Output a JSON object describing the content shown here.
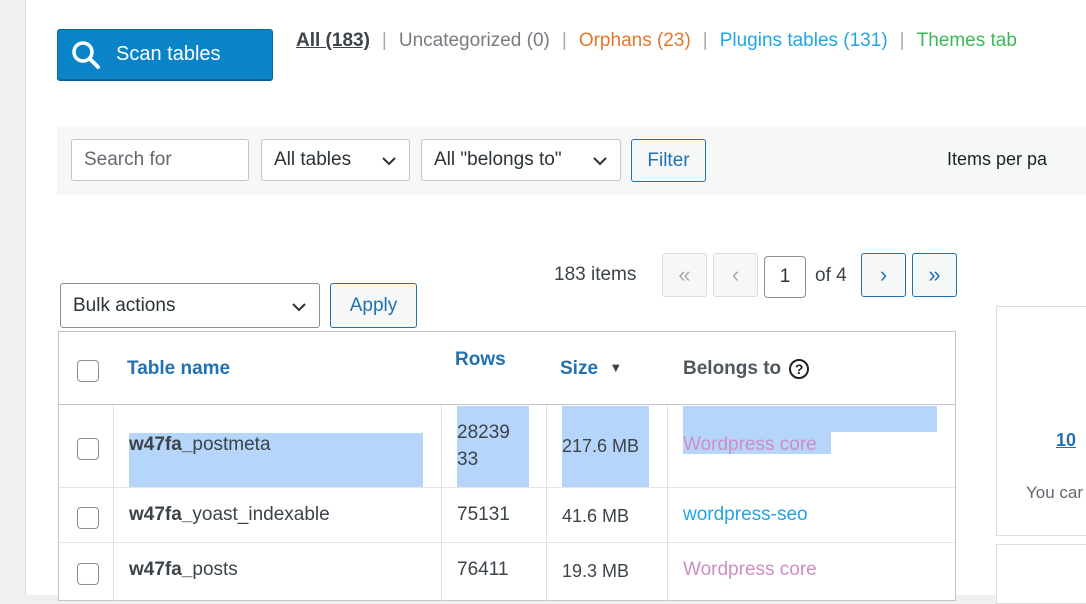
{
  "scan_button": {
    "label": "Scan tables"
  },
  "filters": {
    "all": "All (183)",
    "uncategorized": "Uncategorized (0)",
    "orphans": "Orphans (23)",
    "plugins": "Plugins tables (131)",
    "themes": "Themes tab",
    "separator": "|"
  },
  "search": {
    "placeholder": "Search for"
  },
  "table_filter": {
    "selected": "All tables"
  },
  "belongs_filter": {
    "selected": "All \"belongs to\""
  },
  "filter_button": {
    "label": "Filter"
  },
  "items_per_page": {
    "label": "Items per pa"
  },
  "bulk": {
    "selected": "Bulk actions",
    "apply_label": "Apply"
  },
  "pagination": {
    "count": "183 items",
    "first": "«",
    "prev": "‹",
    "current": "1",
    "of": "of 4",
    "next": "›",
    "last": "»"
  },
  "table": {
    "headers": {
      "name": "Table name",
      "rows": "Rows",
      "size": "Size",
      "size_sort": "▼",
      "belongs": "Belongs to",
      "help": "?"
    },
    "rows": [
      {
        "prefix": "w47fa_",
        "name": "postmeta",
        "rows_line1": "28239",
        "rows_line2": "33",
        "size": "217.6 MB",
        "belongs": "Wordpress core",
        "belongs_type": "core"
      },
      {
        "prefix": "w47fa_",
        "name": "yoast_indexable",
        "rows": "75131",
        "size": "41.6 MB",
        "belongs": "wordpress-seo",
        "belongs_type": "plugin"
      },
      {
        "prefix": "w47fa_",
        "name": "posts",
        "rows": "76411",
        "size": "19.3 MB",
        "belongs": "Wordpress core",
        "belongs_type": "core"
      }
    ]
  },
  "side_panel": {
    "link": "10",
    "text": "You car"
  },
  "colors": {
    "primary": "#0a84c6",
    "link": "#2271b1",
    "orphans": "#e2772e",
    "plugins": "#22a5e0",
    "themes": "#3cb954",
    "core": "#cf8ec3",
    "highlight": "#b6d5fb"
  }
}
